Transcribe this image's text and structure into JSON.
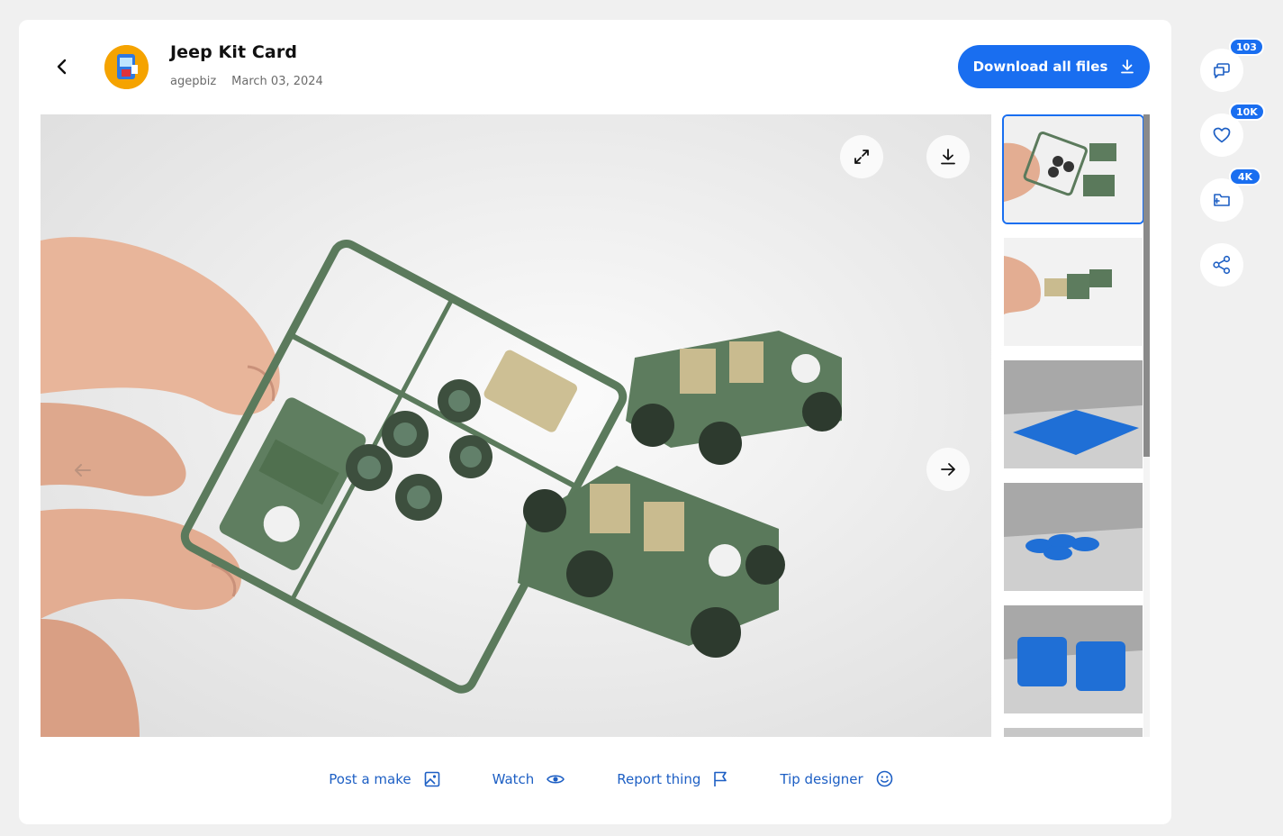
{
  "header": {
    "title": "Jeep Kit Card",
    "author": "agepbiz",
    "date": "March 03, 2024",
    "download_label": "Download all files"
  },
  "viewer": {
    "image_subject": "green plastic jeep model kit card with two assembled jeeps"
  },
  "thumbnails": [
    {
      "subject": "kit card photo",
      "selected": true
    },
    {
      "subject": "hand holding jeep photo",
      "selected": false
    },
    {
      "subject": "blue 3d render of kit card",
      "selected": false
    },
    {
      "subject": "blue 3d render of wheels",
      "selected": false
    },
    {
      "subject": "blue 3d render of seats",
      "selected": false
    }
  ],
  "actions": {
    "post_make": "Post a make",
    "watch": "Watch",
    "report": "Report thing",
    "tip": "Tip designer"
  },
  "side_stats": {
    "comments": "103",
    "likes": "10K",
    "collections": "4K"
  },
  "colors": {
    "accent": "#196ef0",
    "link": "#1d5fc4",
    "jeep_green": "#5e7d5e",
    "render_blue": "#1f6fd6"
  },
  "icons": [
    "chevron-left-icon",
    "expand-icon",
    "download-icon",
    "arrow-right-icon",
    "arrow-left-icon",
    "image-icon",
    "eye-icon",
    "flag-icon",
    "smiley-icon",
    "comments-icon",
    "heart-icon",
    "folder-add-icon",
    "share-icon"
  ]
}
